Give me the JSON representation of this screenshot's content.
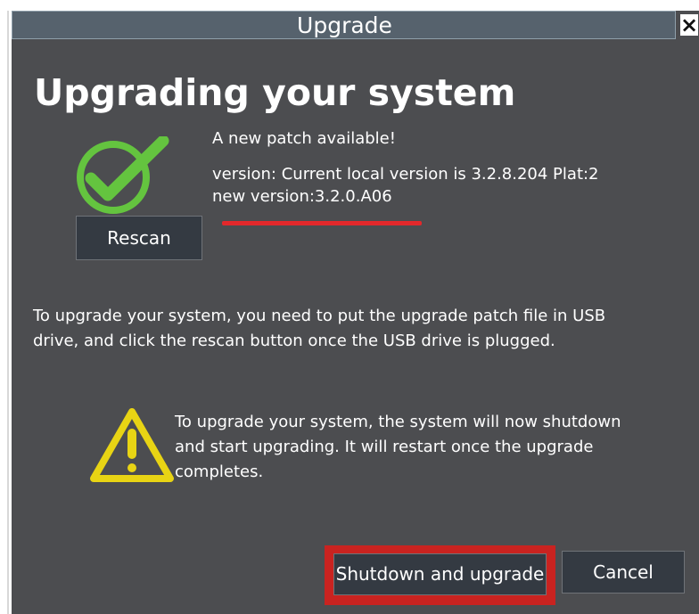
{
  "window": {
    "title": "Upgrade",
    "close_symbol": "×"
  },
  "content": {
    "heading": "Upgrading your system",
    "status_icon": "check-circle-icon",
    "patch_notice": "A new patch available!",
    "current_version": "version: Current local version is 3.2.8.204 Plat:2",
    "new_version": "new version:3.2.0.A06",
    "rescan_label": "Rescan",
    "instruction_line_1": "To upgrade your system, you need to put the upgrade patch file in USB",
    "instruction_line_2": "drive, and click the rescan button once the USB drive is plugged.",
    "warning_icon": "warning-triangle-icon",
    "warning_line_1": "To upgrade your system, the system will now shutdown",
    "warning_line_2": "and start upgrading. It will restart once the upgrade",
    "warning_line_3": "completes."
  },
  "actions": {
    "shutdown_label": "Shutdown and upgrade",
    "cancel_label": "Cancel"
  },
  "colors": {
    "dialog_background": "#4c4d50",
    "titlebar_background": "#56626d",
    "success_green": "#64c43f",
    "warning_yellow": "#e8d414",
    "highlight_red": "#e3282b",
    "button_background": "#343a42"
  }
}
